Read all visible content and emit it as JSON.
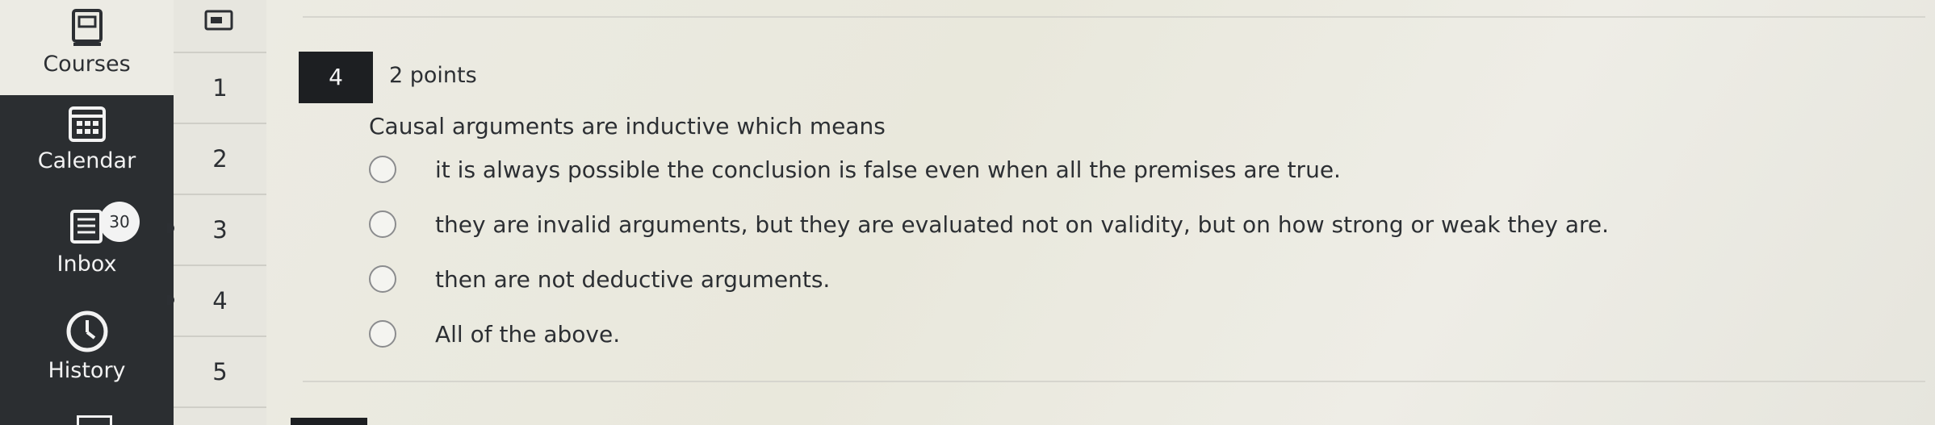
{
  "global_nav": {
    "items": [
      {
        "label": "Courses",
        "icon": "book-icon",
        "active": true
      },
      {
        "label": "Calendar",
        "icon": "calendar-icon"
      },
      {
        "label": "Inbox",
        "icon": "inbox-icon",
        "badge": "30"
      },
      {
        "label": "History",
        "icon": "clock-icon"
      }
    ]
  },
  "question_nav": {
    "numbers": [
      "1",
      "2",
      "3",
      "4",
      "5"
    ]
  },
  "question": {
    "number": "4",
    "points": "2 points",
    "prompt": "Causal arguments are inductive which means",
    "options": [
      "it is always possible the conclusion is false even when all the premises are true.",
      "they are invalid arguments, but they are evaluated not on validity, but on how strong or weak they are.",
      "then are not deductive arguments.",
      "All of the above."
    ]
  }
}
